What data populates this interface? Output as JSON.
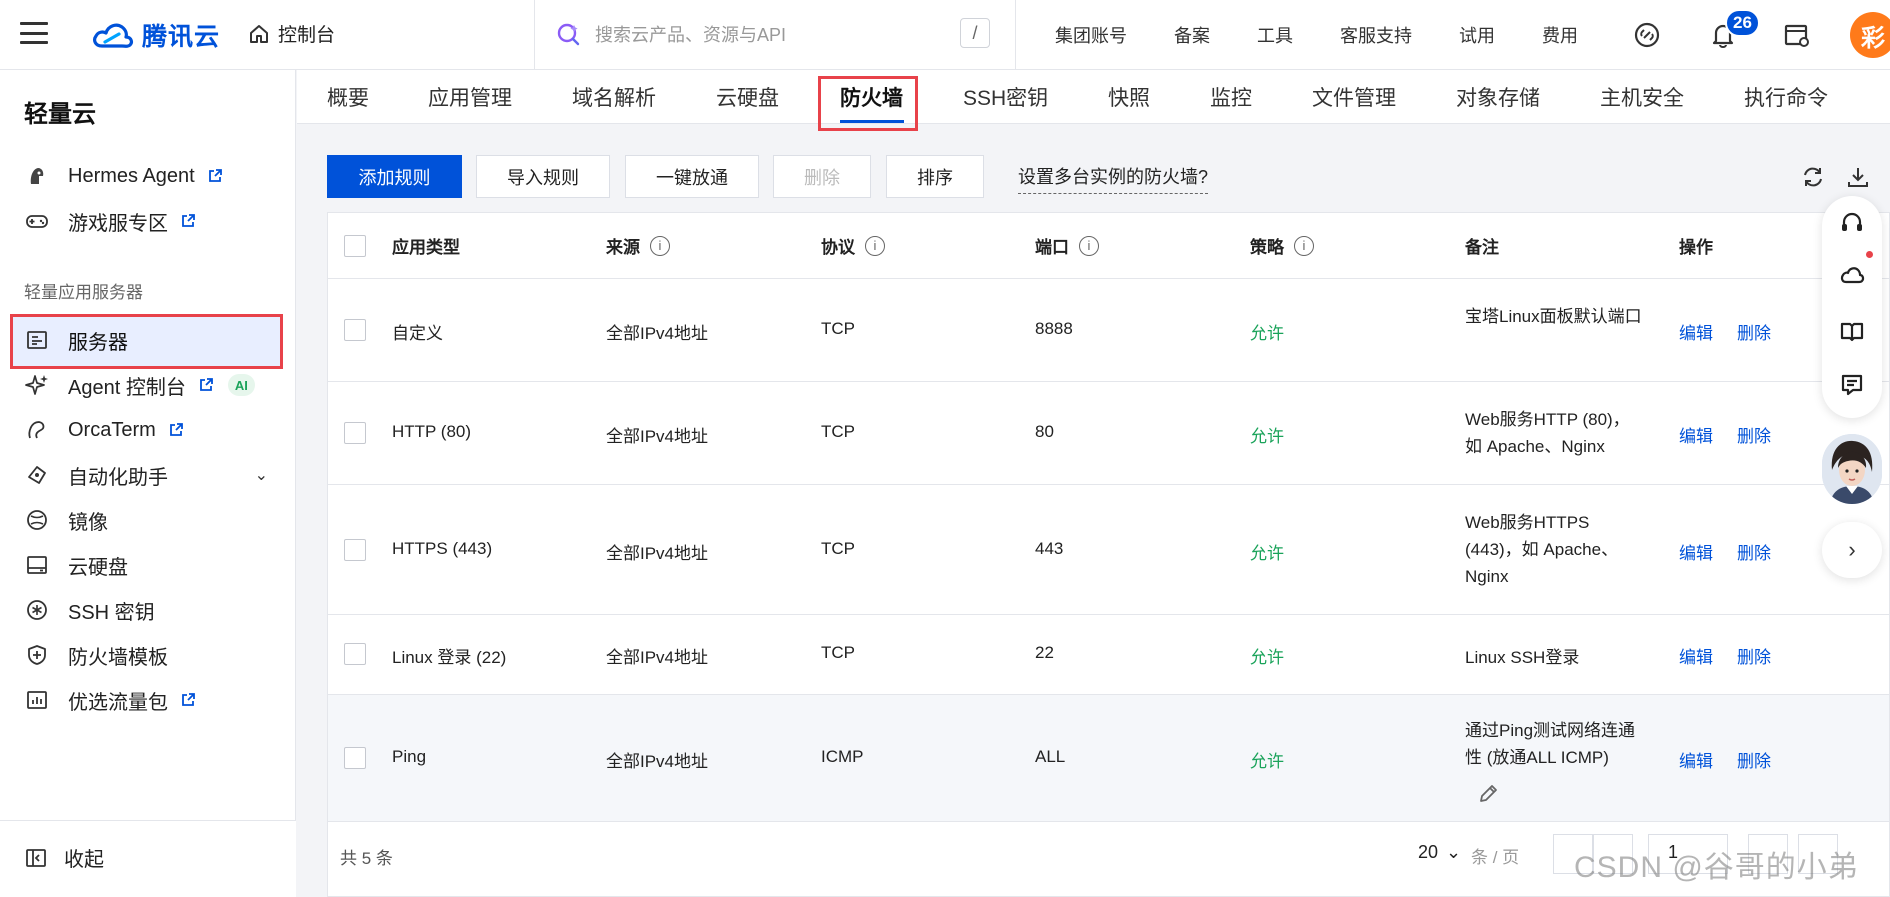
{
  "topbar": {
    "brand": "腾讯云",
    "console": "控制台",
    "search_placeholder": "搜索云产品、资源与API",
    "search_shortcut": "/",
    "links": [
      "集团账号",
      "备案",
      "工具",
      "客服支持",
      "试用",
      "费用"
    ],
    "notification_count": "26",
    "avatar_text": "彩"
  },
  "sidebar": {
    "title": "轻量云",
    "items_top": [
      {
        "label": "Hermes Agent",
        "icon": "hermes-icon",
        "external": true
      },
      {
        "label": "游戏服专区",
        "icon": "gamepad-icon",
        "external": true
      }
    ],
    "group_label": "轻量应用服务器",
    "items": [
      {
        "label": "服务器",
        "icon": "server-icon",
        "active": true
      },
      {
        "label": "Agent 控制台",
        "icon": "sparkle-icon",
        "external": true,
        "tag": "AI"
      },
      {
        "label": "OrcaTerm",
        "icon": "orca-icon",
        "external": true
      },
      {
        "label": "自动化助手",
        "icon": "automation-icon",
        "expandable": true
      },
      {
        "label": "镜像",
        "icon": "image-icon"
      },
      {
        "label": "云硬盘",
        "icon": "disk-icon"
      },
      {
        "label": "SSH 密钥",
        "icon": "key-icon"
      },
      {
        "label": "防火墙模板",
        "icon": "shield-icon"
      },
      {
        "label": "优选流量包",
        "icon": "traffic-icon",
        "external": true
      }
    ],
    "collapse_label": "收起"
  },
  "tabs": {
    "items": [
      "概要",
      "应用管理",
      "域名解析",
      "云硬盘",
      "防火墙",
      "SSH密钥",
      "快照",
      "监控",
      "文件管理",
      "对象存储",
      "主机安全",
      "执行命令"
    ],
    "active": "防火墙"
  },
  "toolbar": {
    "add_rule": "添加规则",
    "import_rules": "导入规则",
    "one_click_open": "一键放通",
    "delete": "删除",
    "sort": "排序",
    "multi_instance_link": "设置多台实例的防火墙?"
  },
  "table": {
    "headers": [
      "应用类型",
      "来源",
      "协议",
      "端口",
      "策略",
      "备注",
      "操作"
    ],
    "edit_label": "编辑",
    "delete_label": "删除",
    "rows": [
      {
        "type": "自定义",
        "source": "全部IPv4地址",
        "protocol": "TCP",
        "port": "8888",
        "policy": "允许",
        "note": "宝塔Linux面板默认端口"
      },
      {
        "type": "HTTP (80)",
        "source": "全部IPv4地址",
        "protocol": "TCP",
        "port": "80",
        "policy": "允许",
        "note": "Web服务HTTP (80)，如 Apache、Nginx"
      },
      {
        "type": "HTTPS (443)",
        "source": "全部IPv4地址",
        "protocol": "TCP",
        "port": "443",
        "policy": "允许",
        "note": "Web服务HTTPS (443)，如 Apache、Nginx"
      },
      {
        "type": "Linux 登录 (22)",
        "source": "全部IPv4地址",
        "protocol": "TCP",
        "port": "22",
        "policy": "允许",
        "note": "Linux SSH登录"
      },
      {
        "type": "Ping",
        "source": "全部IPv4地址",
        "protocol": "ICMP",
        "port": "ALL",
        "policy": "允许",
        "note": "通过Ping测试网络连通性 (放通ALL ICMP)"
      }
    ]
  },
  "footer": {
    "total": "共 5 条",
    "page_size": "20",
    "per_page": "条 / 页",
    "current_page": "1"
  },
  "watermark": "CSDN @谷哥的小弟",
  "colors": {
    "brand": "#0052d9",
    "allow": "#1aa35a",
    "highlight": "#e8424a"
  }
}
